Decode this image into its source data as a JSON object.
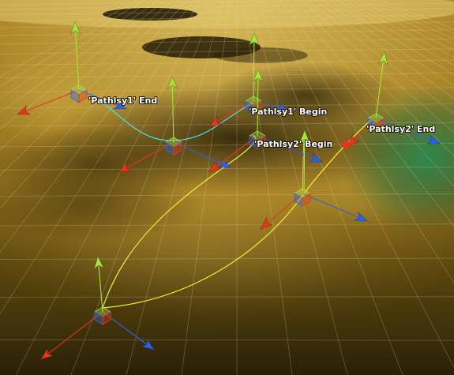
{
  "scene": {
    "view": "Scene viewport",
    "colors": {
      "terrain_light": "#c9a743",
      "terrain_mid": "#8a6d1c",
      "terrain_dark": "#2b2106",
      "grid_line": "#e8dcb0",
      "green_glow": "#1f8a55",
      "axis_x": "#e8361c",
      "axis_y": "#a6e63a",
      "axis_z": "#2a63e8",
      "path_cyan": "#49e1e6",
      "path_yellow": "#f2ee38",
      "label_text": "#ffffff"
    }
  },
  "labels": {
    "path1_end": "'Pathlsy1' End",
    "path1_begin": "'Pathlsy1' Begin",
    "path2_begin": "'Pathlsy2' Begin",
    "path2_end": "'Pathlsy2' End"
  },
  "paths": [
    {
      "name": "Pathlsy1",
      "color": "cyan"
    },
    {
      "name": "Pathlsy2",
      "color": "yellow"
    }
  ],
  "gizmo_icons": [
    "move-gizmo-icon",
    "path-node-icon"
  ]
}
